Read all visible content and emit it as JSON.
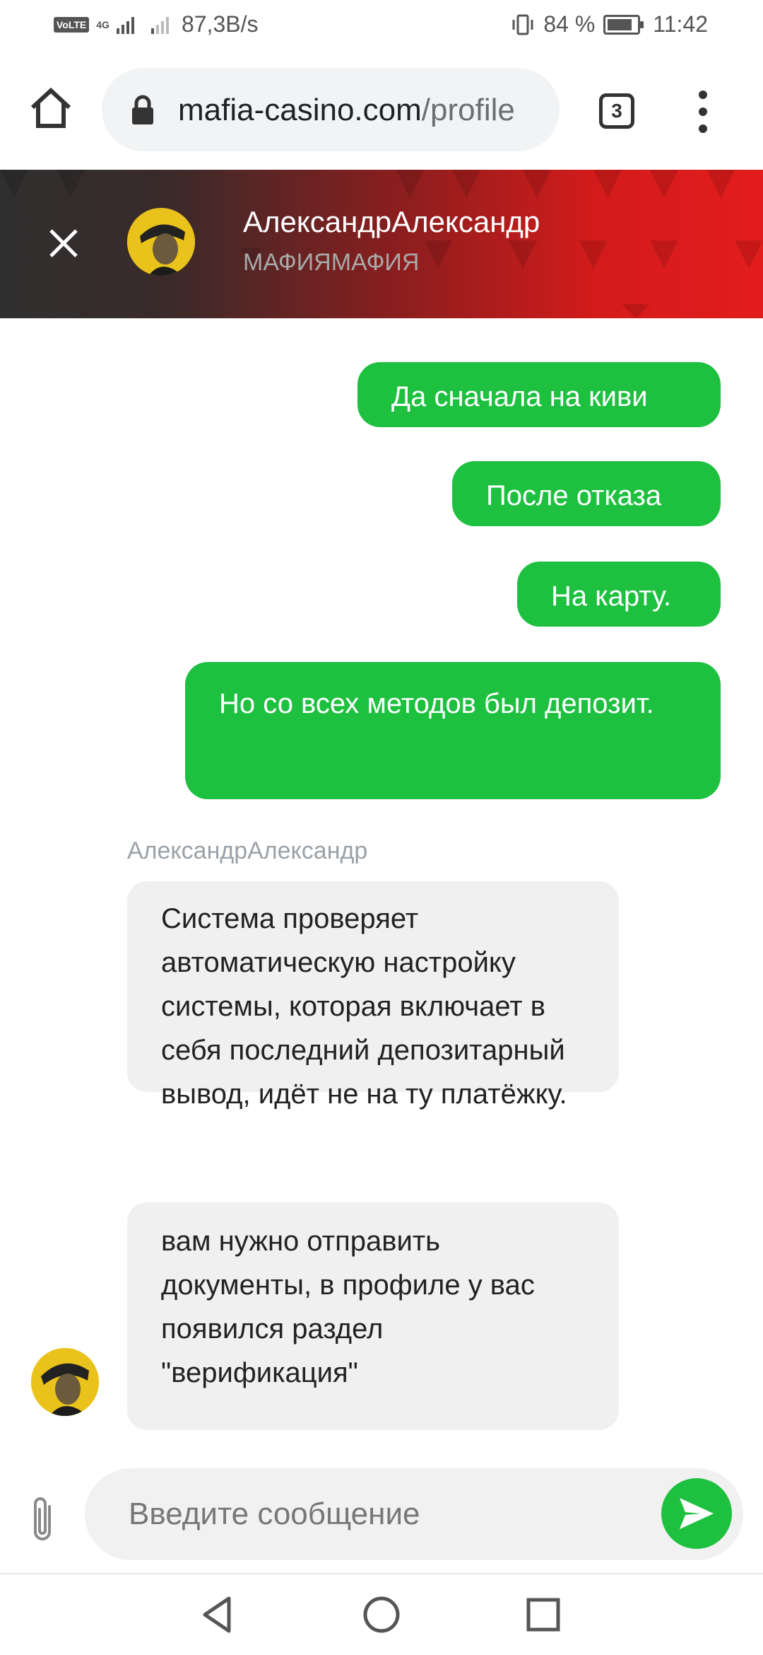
{
  "status_bar": {
    "volte": "VoLTE",
    "network_type": "4G",
    "speed": "87,3B/s",
    "battery_percent": "84 %",
    "battery_level": 0.84,
    "time": "11:42"
  },
  "browser": {
    "url_domain": "mafia-casino.com",
    "url_path": "/profile",
    "tab_count": "3"
  },
  "chat_header": {
    "name": "АлександрАлександр",
    "subtitle": "МАФИЯМАФИЯ"
  },
  "messages": {
    "outgoing": [
      {
        "text": "Да сначала на киви"
      },
      {
        "text": "После отказа"
      },
      {
        "text": "На карту."
      },
      {
        "text": "Но со всех методов был депозит."
      }
    ],
    "sender_name": "АлександрАлександр",
    "incoming": [
      {
        "text": "Система проверяет автоматическую настройку системы, которая включает в себя последний депозитарный вывод, идёт не на ту платёжку."
      },
      {
        "text": "вам нужно отправить документы, в профиле у вас появился раздел \"верификация\""
      }
    ]
  },
  "composer": {
    "placeholder": "Введите сообщение"
  },
  "icons": {
    "home": "home-icon",
    "lock": "lock-icon",
    "menu": "more-vert-icon",
    "close": "close-icon",
    "attach": "paperclip-icon",
    "send": "send-icon",
    "nav_back": "triangle-back-icon",
    "nav_home": "circle-home-icon",
    "nav_recents": "square-recents-icon"
  },
  "colors": {
    "bubble_outgoing": "#1ec040",
    "bubble_incoming": "#f0f0f0",
    "header_red": "#e31c1c",
    "header_dark": "#2f2f2f"
  }
}
